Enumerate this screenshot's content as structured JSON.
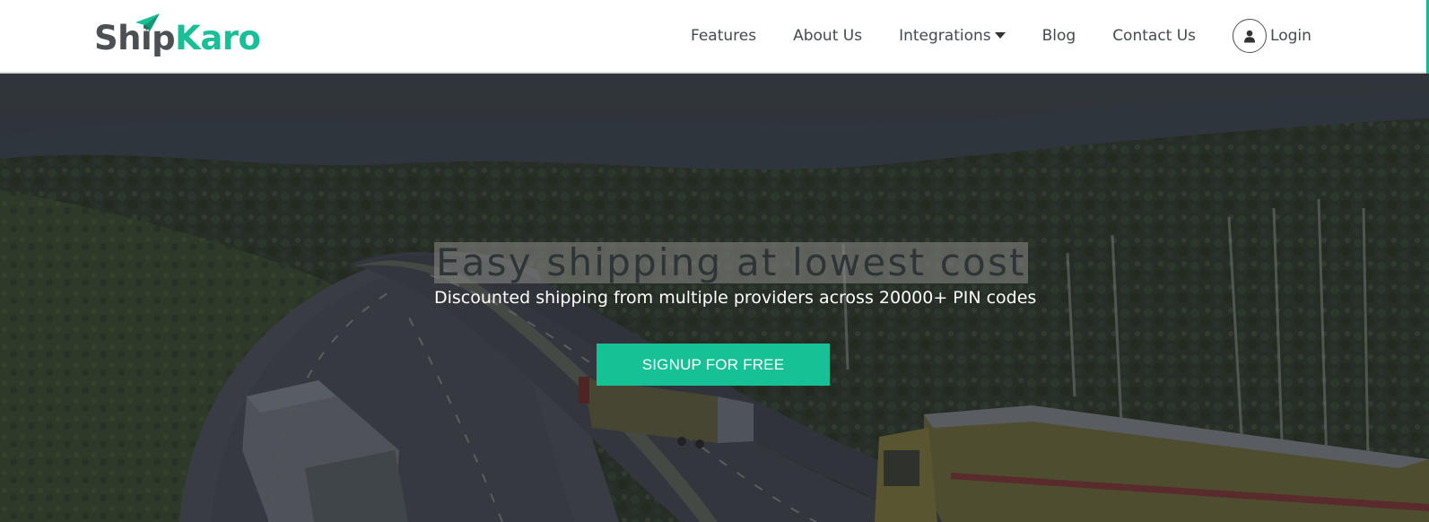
{
  "brand": {
    "name_part1": "Ship",
    "name_part2": "Karo",
    "colors": {
      "primary": "#18bf97",
      "dark": "#4d5052"
    },
    "logo_icon": "paper-plane-icon"
  },
  "nav": {
    "items": [
      {
        "label": "Features"
      },
      {
        "label": "About Us"
      },
      {
        "label": "Integrations",
        "icon": "caret-down-icon"
      },
      {
        "label": "Blog"
      },
      {
        "label": "Contact Us"
      }
    ],
    "login": {
      "label": "Login",
      "icon": "user-icon"
    }
  },
  "hero": {
    "title": "Easy shipping at lowest cost",
    "subtitle": "Discounted shipping from multiple providers across 20000+ PIN codes",
    "cta_label": "SIGNUP FOR FREE",
    "background_description_icon": "highway-trucks-photo"
  }
}
